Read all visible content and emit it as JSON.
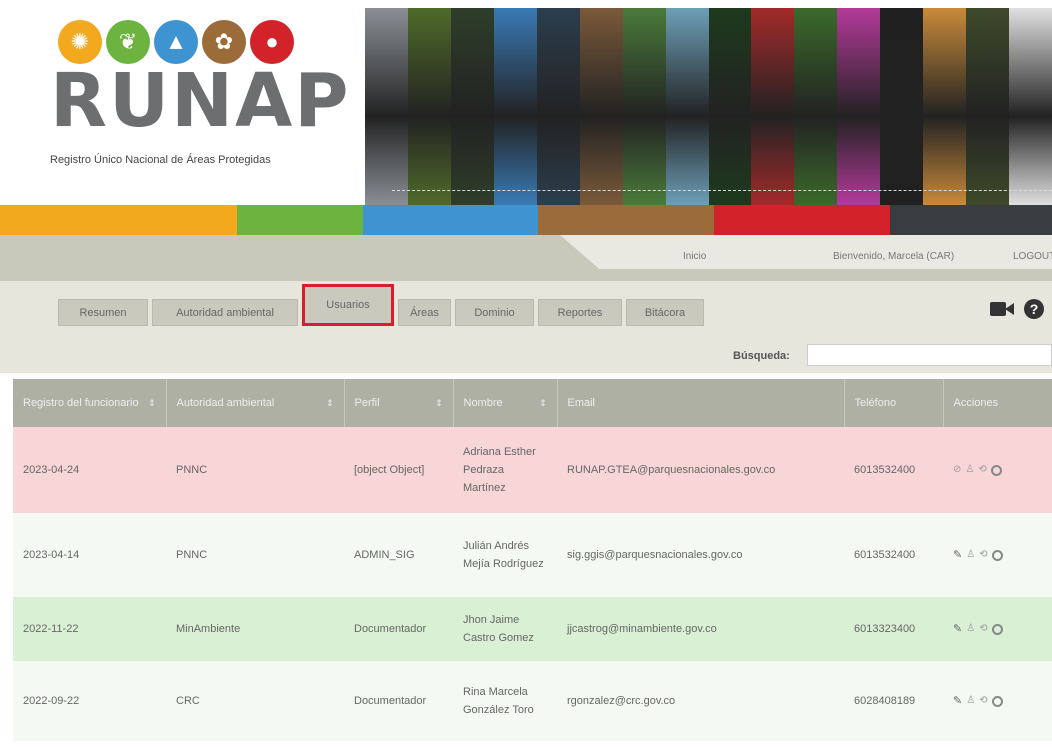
{
  "header": {
    "logo_word": "RUNAP",
    "logo_subtitle": "Registro Único Nacional de Áreas Protegidas",
    "logo_icons": [
      {
        "name": "palm-icon",
        "glyph": "🌴",
        "color": "#f2a91e"
      },
      {
        "name": "leaf-icon",
        "glyph": "❦",
        "color": "#6db33f"
      },
      {
        "name": "mountain-icon",
        "glyph": "▲",
        "color": "#3e93d1"
      },
      {
        "name": "plant-icon",
        "glyph": "✿",
        "color": "#9c6b3a"
      },
      {
        "name": "bear-icon",
        "glyph": "●",
        "color": "#d2232a"
      }
    ],
    "banner_strips": [
      "#8a8f95",
      "#4f6b2a",
      "#2e3e2a",
      "#3a7ab5",
      "#2c3e4d",
      "#7a5a3a",
      "#4a7a3a",
      "#6d9fb8",
      "#1e3a1e",
      "#a32a2a",
      "#3b6a2a",
      "#b43a9a",
      "#202020",
      "#c98a3a",
      "#3e4a2a",
      "#e0e0e0"
    ]
  },
  "colorbar": [
    "#f2a91e",
    "#6db33f",
    "#3e93d1",
    "#9c6b3a",
    "#d2232a",
    "#3a3d40"
  ],
  "nav": {
    "home": "Inicio",
    "welcome": "Bienvenido, Marcela (CAR)",
    "logout": "LOGOUT"
  },
  "tabs": [
    "Resumen",
    "Autoridad ambiental",
    "Usuarios",
    "Áreas",
    "Dominio",
    "Reportes",
    "Bitácora"
  ],
  "active_tab": "Usuarios",
  "search": {
    "label": "Búsqueda:",
    "value": ""
  },
  "table": {
    "headers": [
      "Registro del funcionario",
      "Autoridad ambiental",
      "Perfil",
      "Nombre",
      "Email",
      "Teléfono",
      "Acciones"
    ],
    "rows": [
      {
        "date": "2023-04-24",
        "authority": "PNNC",
        "profile": "[object Object]",
        "name": "Adriana Esther Pedraza Martínez",
        "email": "RUNAP.GTEA@parquesnacionales.gov.co",
        "phone": "6013532400"
      },
      {
        "date": "2023-04-14",
        "authority": "PNNC",
        "profile": "ADMIN_SIG",
        "name": "Julián Andrés Mejía Rodríguez",
        "email": "sig.ggis@parquesnacionales.gov.co",
        "phone": "6013532400"
      },
      {
        "date": "2022-11-22",
        "authority": "MinAmbiente",
        "profile": "Documentador",
        "name": "Jhon Jaime Castro Gomez",
        "email": "jjcastrog@minambiente.gov.co",
        "phone": "6013323400"
      },
      {
        "date": "2022-09-22",
        "authority": "CRC",
        "profile": "Documentador",
        "name": "Rina Marcela González Toro",
        "email": "rgonzalez@crc.gov.co",
        "phone": "6028408189"
      }
    ]
  }
}
